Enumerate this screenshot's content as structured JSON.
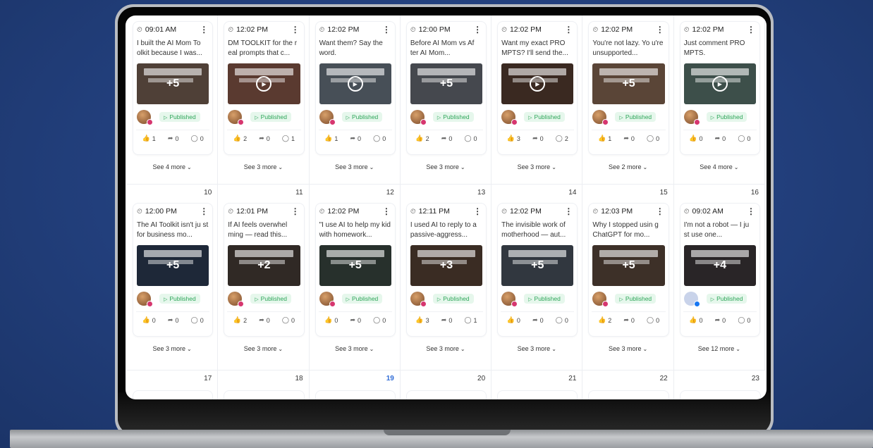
{
  "calendar": {
    "row1": {
      "days": [
        "10",
        "11",
        "12",
        "13",
        "14",
        "15",
        "16"
      ],
      "posts": [
        {
          "time": "09:01 AM",
          "caption": "I built the AI Mom To olkit because I was...",
          "media": "+5",
          "media_kind": "multi",
          "thumb": "#7a6355",
          "status": "Published",
          "avatar": "ig",
          "likes": "1",
          "shares": "0",
          "comments": "0",
          "see_more": "See 4 more"
        },
        {
          "time": "12:02 PM",
          "caption": "DM TOOLKIT for the r eal prompts that c...",
          "media": "▶",
          "media_kind": "video",
          "thumb": "#8a5a4a",
          "status": "Published",
          "avatar": "ig",
          "likes": "2",
          "shares": "0",
          "comments": "1",
          "see_more": "See 3 more"
        },
        {
          "time": "12:02 PM",
          "caption": "Want them? Say the word.",
          "media": "▶",
          "media_kind": "video",
          "thumb": "#6d7a86",
          "status": "Published",
          "avatar": "ig",
          "likes": "1",
          "shares": "0",
          "comments": "0",
          "see_more": "See 3 more"
        },
        {
          "time": "12:00 PM",
          "caption": "Before AI Mom vs Af ter AI Mom...",
          "media": "+5",
          "media_kind": "multi",
          "thumb": "#6b6f78",
          "status": "Published",
          "avatar": "ig",
          "likes": "2",
          "shares": "0",
          "comments": "0",
          "see_more": "See 3 more"
        },
        {
          "time": "12:02 PM",
          "caption": "Want my exact PRO MPTS? I'll send the...",
          "media": "▶",
          "media_kind": "video",
          "thumb": "#5a4034",
          "status": "Published",
          "avatar": "ig",
          "likes": "3",
          "shares": "0",
          "comments": "2",
          "see_more": "See 3 more"
        },
        {
          "time": "12:02 PM",
          "caption": "You're not lazy. Yo u're unsupported...",
          "media": "+5",
          "media_kind": "multi",
          "thumb": "#8a6a55",
          "status": "Published",
          "avatar": "ig",
          "likes": "1",
          "shares": "0",
          "comments": "0",
          "see_more": "See 2 more"
        },
        {
          "time": "12:02 PM",
          "caption": "Just comment PRO MPTS.",
          "media": "▶",
          "media_kind": "video",
          "thumb": "#5f7a72",
          "status": "Published",
          "avatar": "ig",
          "likes": "0",
          "shares": "0",
          "comments": "0",
          "see_more": "See 4 more"
        }
      ]
    },
    "row2": {
      "days": [
        "17",
        "18",
        "19",
        "20",
        "21",
        "22",
        "23"
      ],
      "today_index": 2,
      "posts": [
        {
          "time": "12:00 PM",
          "caption": "The AI Toolkit isn't ju st for business mo...",
          "media": "+5",
          "media_kind": "multi",
          "thumb": "#2f3e56",
          "status": "Published",
          "avatar": "ig",
          "likes": "0",
          "shares": "0",
          "comments": "0",
          "see_more": "See 3 more"
        },
        {
          "time": "12:01 PM",
          "caption": "If AI feels overwhel ming — read this...",
          "media": "+2",
          "media_kind": "multi",
          "thumb": "#4a3f3a",
          "status": "Published",
          "avatar": "ig",
          "likes": "2",
          "shares": "0",
          "comments": "0",
          "see_more": "See 3 more"
        },
        {
          "time": "12:02 PM",
          "caption": "\"I use AI to help my kid with homework...",
          "media": "+5",
          "media_kind": "multi",
          "thumb": "#3c4a44",
          "status": "Published",
          "avatar": "ig",
          "likes": "0",
          "shares": "0",
          "comments": "0",
          "see_more": "See 3 more"
        },
        {
          "time": "12:11 PM",
          "caption": "I used AI to reply to a passive-aggress...",
          "media": "+3",
          "media_kind": "multi",
          "thumb": "#5a4436",
          "status": "Published",
          "avatar": "ig",
          "likes": "3",
          "shares": "0",
          "comments": "1",
          "see_more": "See 3 more"
        },
        {
          "time": "12:02 PM",
          "caption": "The invisible work of motherhood — aut...",
          "media": "+5",
          "media_kind": "multi",
          "thumb": "#4c5562",
          "status": "Published",
          "avatar": "ig",
          "likes": "0",
          "shares": "0",
          "comments": "0",
          "see_more": "See 3 more"
        },
        {
          "time": "12:03 PM",
          "caption": "Why I stopped usin g ChatGPT for mo...",
          "media": "+5",
          "media_kind": "multi",
          "thumb": "#5e4a3e",
          "status": "Published",
          "avatar": "ig",
          "likes": "2",
          "shares": "0",
          "comments": "0",
          "see_more": "See 3 more"
        },
        {
          "time": "09:02 AM",
          "caption": "I'm not a robot — I ju st use one...",
          "media": "+4",
          "media_kind": "multi",
          "thumb": "#3f3a3c",
          "status": "Published",
          "avatar": "fb",
          "likes": "0",
          "shares": "0",
          "comments": "0",
          "see_more": "See 12 more"
        }
      ]
    }
  },
  "colors": {
    "accent": "#2f6bd6",
    "published_bg": "#e6f7ec",
    "published_fg": "#2fa65a",
    "instagram": "#d6366f",
    "facebook": "#1877f2"
  },
  "icons": {
    "clock": "clock-icon",
    "menu": "kebab-menu-icon",
    "like": "thumbs-up-icon",
    "share": "share-icon",
    "comment": "comment-icon",
    "chevron": "chevron-down-icon",
    "play": "play-icon"
  }
}
